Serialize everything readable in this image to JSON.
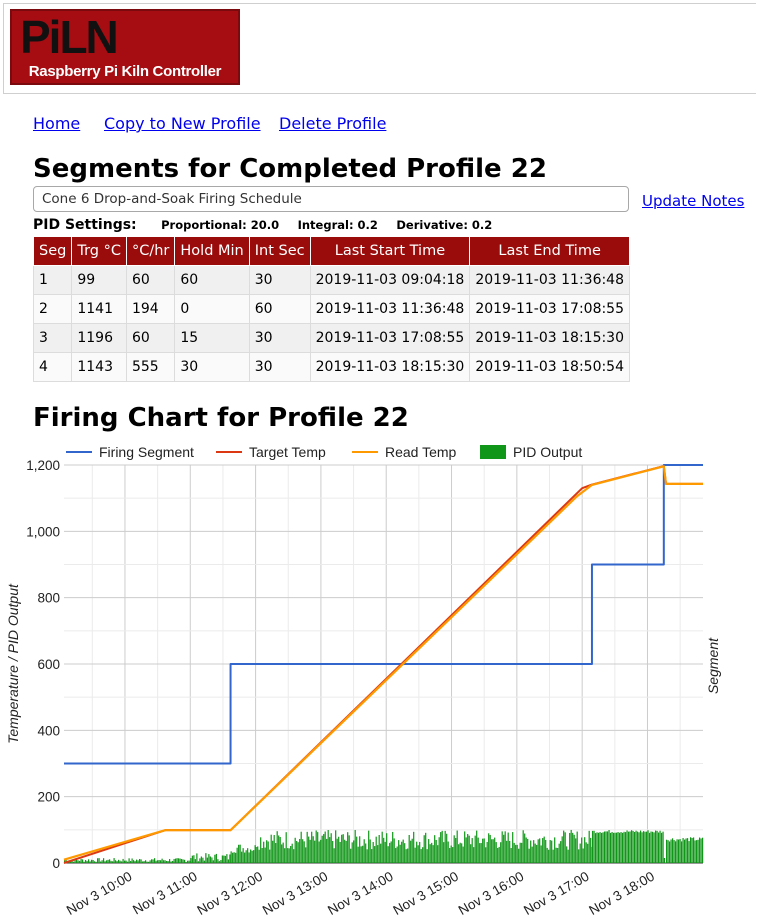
{
  "header": {
    "logo_text": "PiLN",
    "logo_subtitle": "Raspberry Pi Kiln Controller"
  },
  "nav": {
    "home": "Home",
    "copy": "Copy to New Profile",
    "delete": "Delete Profile"
  },
  "segments_title": "Segments for Completed Profile 22",
  "notes": {
    "value": "Cone 6 Drop-and-Soak Firing Schedule",
    "update_label": "Update Notes"
  },
  "pid": {
    "label": "PID Settings:",
    "proportional": "Proportional: 20.0",
    "integral": "Integral: 0.2",
    "derivative": "Derivative: 0.2"
  },
  "table": {
    "headers": [
      "Seg",
      "Trg °C",
      "°C/hr",
      "Hold Min",
      "Int Sec",
      "Last Start Time",
      "Last End Time"
    ],
    "rows": [
      [
        "1",
        "99",
        "60",
        "60",
        "30",
        "2019-11-03 09:04:18",
        "2019-11-03 11:36:48"
      ],
      [
        "2",
        "1141",
        "194",
        "0",
        "60",
        "2019-11-03 11:36:48",
        "2019-11-03 17:08:55"
      ],
      [
        "3",
        "1196",
        "60",
        "15",
        "30",
        "2019-11-03 17:08:55",
        "2019-11-03 18:15:30"
      ],
      [
        "4",
        "1143",
        "555",
        "30",
        "30",
        "2019-11-03 18:15:30",
        "2019-11-03 18:50:54"
      ]
    ]
  },
  "chart_title": "Firing Chart for Profile 22",
  "chart_data": {
    "type": "line",
    "ylabel": "Temperature / PID Output",
    "y2label": "Segment",
    "ylim": [
      0,
      1200
    ],
    "yticks": [
      0,
      200,
      400,
      600,
      800,
      1000,
      1200
    ],
    "ytick_labels": [
      "0",
      "200",
      "400",
      "600",
      "800",
      "1,000",
      "1,200"
    ],
    "xlim": [
      "2019-11-03 09:04",
      "2019-11-03 18:51"
    ],
    "xticks": [
      "Nov 3 10:00",
      "Nov 3 11:00",
      "Nov 3 12:00",
      "Nov 3 13:00",
      "Nov 3 14:00",
      "Nov 3 15:00",
      "Nov 3 16:00",
      "Nov 3 17:00",
      "Nov 3 18:00"
    ],
    "grid": true,
    "legend_position": "top",
    "series": [
      {
        "name": "Firing Segment",
        "color": "#3366cc",
        "style": "step",
        "x": [
          "09:04",
          "11:37",
          "11:37",
          "17:09",
          "17:09",
          "18:15",
          "18:15",
          "18:51"
        ],
        "y": [
          300,
          300,
          600,
          600,
          900,
          900,
          1200,
          1200
        ]
      },
      {
        "name": "Target Temp",
        "color": "#dc3912",
        "style": "line",
        "x": [
          "09:04",
          "10:37",
          "11:37",
          "17:00",
          "17:09",
          "18:14",
          "18:15",
          "18:17",
          "18:51"
        ],
        "y": [
          0,
          99,
          99,
          1130,
          1141,
          1196,
          1196,
          1143,
          1143
        ]
      },
      {
        "name": "Read Temp",
        "color": "#ff9900",
        "style": "line",
        "x": [
          "09:04",
          "10:37",
          "11:37",
          "16:55",
          "17:09",
          "18:15",
          "18:17",
          "18:51"
        ],
        "y": [
          10,
          99,
          99,
          1105,
          1140,
          1196,
          1143,
          1143
        ]
      },
      {
        "name": "PID Output",
        "color": "#109618",
        "style": "bars",
        "segments": [
          {
            "from": "09:04",
            "to": "11:00",
            "min": 3,
            "max": 15
          },
          {
            "from": "11:00",
            "to": "11:36",
            "min": 5,
            "max": 30
          },
          {
            "from": "11:37",
            "to": "12:00",
            "min": 30,
            "max": 60
          },
          {
            "from": "12:00",
            "to": "17:09",
            "min": 40,
            "max": 100
          },
          {
            "from": "17:09",
            "to": "18:15",
            "min": 90,
            "max": 100
          },
          {
            "from": "18:15",
            "to": "18:17",
            "min": 0,
            "max": 20
          },
          {
            "from": "18:17",
            "to": "18:51",
            "min": 65,
            "max": 78
          }
        ]
      }
    ]
  }
}
